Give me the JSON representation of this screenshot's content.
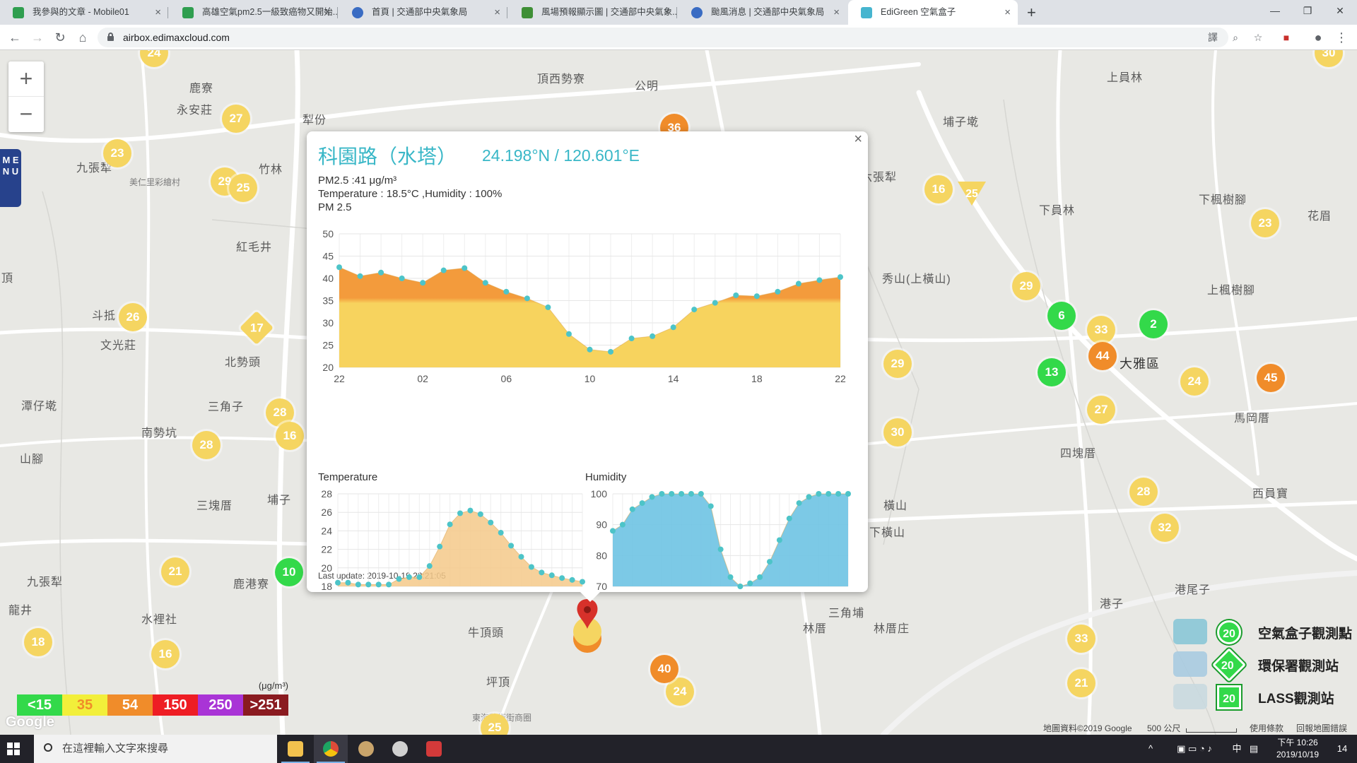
{
  "browser": {
    "tabs": [
      {
        "title": "我參與的文章 - Mobile01",
        "color": "#2f9e4f"
      },
      {
        "title": "高雄空氣pm2.5一級致癌物又開始...",
        "color": "#2f9e4f"
      },
      {
        "title": "首頁 | 交通部中央氣象局",
        "color": "#3a6cc3"
      },
      {
        "title": "風場預報顯示圖 | 交通部中央氣象...",
        "color": "#3f8f36"
      },
      {
        "title": "颱風消息 | 交通部中央氣象局",
        "color": "#3a6cc3"
      },
      {
        "title": "EdiGreen 空氣盒子",
        "color": "#46b5cf"
      }
    ],
    "tab_close_glyph": "×",
    "new_tab_glyph": "+",
    "window_controls": {
      "minimize": "—",
      "maximize": "❐",
      "close": "✕"
    },
    "nav": {
      "back": "←",
      "forward": "→",
      "reload": "↻",
      "home": "⌂"
    },
    "url": "airbox.edimaxcloud.com",
    "toolbar_icons": {
      "translate": "譯",
      "zoom": "⌕",
      "star": "☆",
      "ext": "■",
      "profile": "●",
      "menu": "⋮"
    }
  },
  "map": {
    "zoom_in": "+",
    "zoom_out": "−",
    "menu_label": "M E N U",
    "places": [
      "頂西勢寮",
      "公明",
      "鹿寮",
      "永安莊",
      "犁份",
      "竹林",
      "九張犁",
      "美仁里彩繪村",
      "紅毛井",
      "斗抵",
      "文光莊",
      "北勢頭",
      "三角子",
      "潭仔墘",
      "南勢坑",
      "山腳",
      "三塊厝",
      "埔子",
      "九張犁",
      "龍井",
      "鹿港寮",
      "水裡社",
      "牛頂頭",
      "坪頂",
      "東海藝術街商圈",
      "埔子墘",
      "六張犁",
      "下員林",
      "秀山(上橫山)",
      "下楓樹腳",
      "花眉",
      "上楓樹腳",
      "大雅區",
      "四塊厝",
      "馬岡厝",
      "西員寶",
      "港子",
      "港尾子",
      "林厝",
      "三角埔",
      "林厝庄",
      "橫山",
      "下橫山",
      "上員林",
      "頂"
    ],
    "markers": [
      {
        "v": "24",
        "k": "y"
      },
      {
        "v": "27",
        "k": "y"
      },
      {
        "v": "23",
        "k": "y"
      },
      {
        "v": "29",
        "k": "y"
      },
      {
        "v": "25",
        "k": "y"
      },
      {
        "v": "36",
        "k": "o"
      },
      {
        "v": "26",
        "k": "y"
      },
      {
        "v": "17",
        "k": "d"
      },
      {
        "v": "28",
        "k": "y"
      },
      {
        "v": "16",
        "k": "y"
      },
      {
        "v": "28",
        "k": "y"
      },
      {
        "v": "21",
        "k": "y"
      },
      {
        "v": "10",
        "k": "g"
      },
      {
        "v": "18",
        "k": "y"
      },
      {
        "v": "16",
        "k": "y"
      },
      {
        "v": "25",
        "k": "y"
      },
      {
        "v": "24",
        "k": "y"
      },
      {
        "v": "40",
        "k": "o"
      },
      {
        "v": "16",
        "k": "y"
      },
      {
        "v": "25",
        "k": "t"
      },
      {
        "v": "29",
        "k": "y"
      },
      {
        "v": "6",
        "k": "g"
      },
      {
        "v": "33",
        "k": "y"
      },
      {
        "v": "2",
        "k": "g"
      },
      {
        "v": "44",
        "k": "o"
      },
      {
        "v": "13",
        "k": "g"
      },
      {
        "v": "29",
        "k": "y"
      },
      {
        "v": "24",
        "k": "y"
      },
      {
        "v": "45",
        "k": "o"
      },
      {
        "v": "27",
        "k": "y"
      },
      {
        "v": "30",
        "k": "y"
      },
      {
        "v": "28",
        "k": "y"
      },
      {
        "v": "32",
        "k": "y"
      },
      {
        "v": "23",
        "k": "y"
      },
      {
        "v": "33",
        "k": "y"
      },
      {
        "v": "21",
        "k": "y"
      },
      {
        "v": "30",
        "k": "y"
      }
    ],
    "legend": {
      "unit": "(μg/m³)",
      "items": [
        {
          "label": "<15",
          "color": "#33d94a"
        },
        {
          "label": "35",
          "color": "#f2ef3a"
        },
        {
          "label": "54",
          "color": "#f08c2a"
        },
        {
          "label": "150",
          "color": "#ee1d24"
        },
        {
          "label": "250",
          "color": "#a934d6"
        },
        {
          "label": ">251",
          "color": "#8a1b20"
        }
      ]
    },
    "google_mark": "Google",
    "stations": [
      {
        "value": "20",
        "label": "空氣盒子觀測點"
      },
      {
        "value": "20",
        "label": "環保署觀測站"
      },
      {
        "value": "20",
        "label": "LASS觀測站"
      }
    ],
    "attribution": {
      "data": "地圖資料©2019 Google",
      "scale": "500 公尺",
      "terms": "使用條款",
      "report": "回報地圖錯誤"
    }
  },
  "popup": {
    "close": "×",
    "title": "科園路（水塔）",
    "coords": "24.198°N / 120.601°E",
    "pm25": "PM2.5 :41 μg/m³",
    "temp_humidity": "Temperature : 18.5°C ,Humidity : 100%",
    "pm_label": "PM 2.5",
    "temp_label": "Temperature",
    "humidity_label": "Humidity",
    "last_update": "Last update: 2019-10-19 22:21:05"
  },
  "chart_data": [
    {
      "type": "area",
      "title": "PM 2.5",
      "x": [
        "22",
        "23",
        "00",
        "01",
        "02",
        "03",
        "04",
        "05",
        "06",
        "07",
        "08",
        "09",
        "10",
        "11",
        "12",
        "13",
        "14",
        "15",
        "16",
        "17",
        "18",
        "19",
        "20",
        "21",
        "22"
      ],
      "x_ticks": [
        "22",
        "02",
        "06",
        "10",
        "14",
        "18",
        "22"
      ],
      "y_ticks": [
        20,
        25,
        30,
        35,
        40,
        45,
        50
      ],
      "ylim": [
        20,
        50
      ],
      "values": [
        42.5,
        40.5,
        41.3,
        40,
        39,
        41.8,
        42.3,
        39,
        37,
        35.5,
        33.5,
        27.5,
        24,
        23.5,
        26.5,
        27,
        29,
        33,
        34.5,
        36.2,
        36,
        37,
        38.8,
        39.6,
        40.3
      ],
      "colors": {
        "band_high": "#f39b3c",
        "band_low": "#f7d35e",
        "line": "#4dc4c8",
        "band_threshold": 35
      }
    },
    {
      "type": "area",
      "title": "Temperature",
      "x": [
        "22",
        "23",
        "00",
        "01",
        "02",
        "03",
        "04",
        "05",
        "06",
        "07",
        "08",
        "09",
        "10",
        "11",
        "12",
        "13",
        "14",
        "15",
        "16",
        "17",
        "18",
        "19",
        "20",
        "21",
        "22"
      ],
      "y_ticks": [
        18,
        20,
        22,
        24,
        26,
        28
      ],
      "ylim": [
        18,
        28
      ],
      "values": [
        18.4,
        18.4,
        18.2,
        18.2,
        18.2,
        18.2,
        18.8,
        19,
        19,
        20.2,
        22.3,
        24.7,
        25.9,
        26.2,
        25.8,
        24.9,
        23.8,
        22.4,
        21.2,
        20.1,
        19.5,
        19.2,
        18.9,
        18.7,
        18.5
      ],
      "colors": {
        "fill": "#f5c98a",
        "line": "#4dc4c8"
      }
    },
    {
      "type": "area",
      "title": "Humidity",
      "x": [
        "22",
        "23",
        "00",
        "01",
        "02",
        "03",
        "04",
        "05",
        "06",
        "07",
        "08",
        "09",
        "10",
        "11",
        "12",
        "13",
        "14",
        "15",
        "16",
        "17",
        "18",
        "19",
        "20",
        "21",
        "22"
      ],
      "y_ticks": [
        70,
        80,
        90,
        100
      ],
      "ylim": [
        70,
        100
      ],
      "values": [
        88,
        90,
        95,
        97,
        99,
        100,
        100,
        100,
        100,
        100,
        96,
        82,
        73,
        70,
        71,
        73,
        78,
        85,
        92,
        97,
        99,
        100,
        100,
        100,
        100
      ],
      "colors": {
        "fill": "#6ec3e3",
        "line": "#4dc4c8"
      }
    }
  ],
  "taskbar": {
    "search_placeholder": "在這裡輸入文字來搜尋",
    "apps": [
      {
        "name": "file-explorer",
        "color": "#f2c14e"
      },
      {
        "name": "chrome",
        "color": "#de4b39"
      },
      {
        "name": "app-3",
        "color": "#c9a46b"
      },
      {
        "name": "app-4",
        "color": "#d0d0d0"
      },
      {
        "name": "app-5",
        "color": "#d33a3a"
      }
    ],
    "tray": {
      "chevron": "^",
      "ime": "中",
      "notify": "▤",
      "time": "下午 10:26",
      "date": "2019/10/19",
      "badge": "14"
    }
  }
}
